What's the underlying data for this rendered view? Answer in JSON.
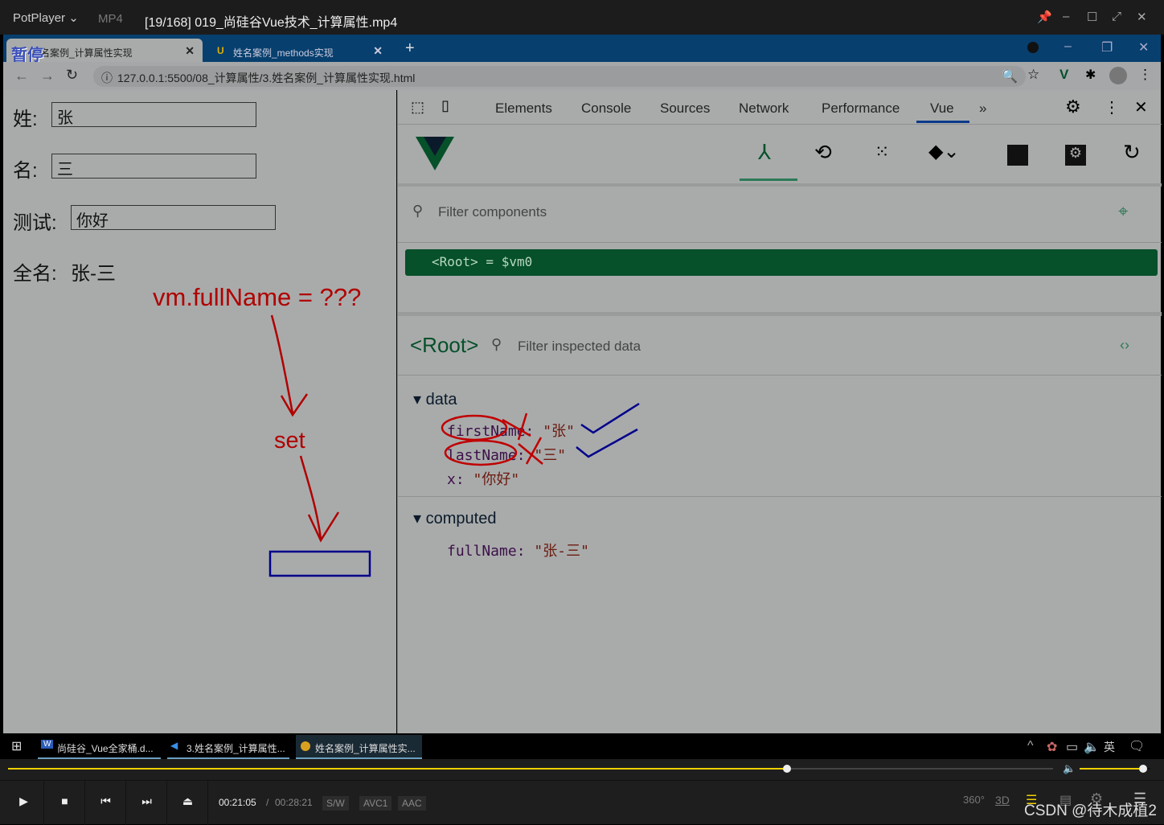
{
  "player": {
    "app": "PotPlayer",
    "format": "MP4",
    "title": "[19/168] 019_尚硅谷Vue技术_计算属性.mp4",
    "paused_label": "暂停",
    "time_current": "00:21:05",
    "time_total": "00:28:21",
    "badges": [
      "S/W",
      "AVC1",
      "AAC"
    ],
    "progress": 0.745,
    "volume": 0.9,
    "watermark": "CSDN @待木成植2",
    "accent": "#f0d000"
  },
  "browser": {
    "tabs": [
      {
        "label": "姓名案例_计算属性实现"
      },
      {
        "label": "姓名案例_methods实现"
      }
    ],
    "url": "127.0.0.1:5500/08_计算属性/3.姓名案例_计算属性实现.html"
  },
  "page": {
    "surname_label": "姓:",
    "surname_value": "张",
    "name_label": "名:",
    "name_value": "三",
    "test_label": "测试:",
    "test_value": "你好",
    "fullname_label": "全名:",
    "fullname_value": "张-三",
    "annot_assign": "vm.fullName = ???",
    "annot_set": "set"
  },
  "devtools": {
    "tabs": [
      "Elements",
      "Console",
      "Sources",
      "Network",
      "Performance",
      "Vue"
    ],
    "active_tab": "Vue",
    "filter_components_placeholder": "Filter components",
    "root_row": "<Root> = $vm0",
    "inspected_title": "<Root>",
    "filter_inspected_placeholder": "Filter inspected data",
    "data_section": "data",
    "data": [
      {
        "key": "firstName",
        "value": "\"张\""
      },
      {
        "key": "lastName",
        "value": "\"三\""
      },
      {
        "key": "x",
        "value": "\"你好\""
      }
    ],
    "computed_section": "computed",
    "computed": [
      {
        "key": "fullName",
        "value": "\"张-三\""
      }
    ],
    "vue_green": "#06502a"
  },
  "taskbar": {
    "items": [
      "尚硅谷_Vue全家桶.d...",
      "3.姓名案例_计算属性...",
      "姓名案例_计算属性实..."
    ],
    "ime": "英"
  }
}
